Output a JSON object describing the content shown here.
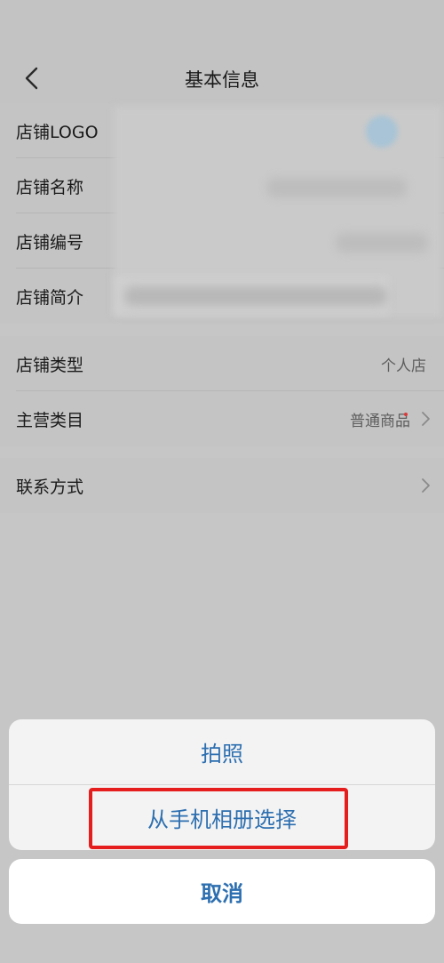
{
  "nav": {
    "title": "基本信息"
  },
  "basic_info": {
    "rows": [
      {
        "label": "店铺LOGO"
      },
      {
        "label": "店铺名称"
      },
      {
        "label": "店铺编号"
      },
      {
        "label": "店铺简介"
      }
    ]
  },
  "shop_type": {
    "label": "店铺类型",
    "value": "个人店"
  },
  "main_category": {
    "label": "主营类目",
    "value": "普通商品"
  },
  "contact": {
    "label": "联系方式"
  },
  "action_sheet": {
    "take_photo": "拍照",
    "choose_album": "从手机相册选择",
    "cancel": "取消"
  },
  "colors": {
    "accent": "#2d6fb0",
    "highlight": "#e51d1d",
    "required_dot": "#d83a3a"
  }
}
